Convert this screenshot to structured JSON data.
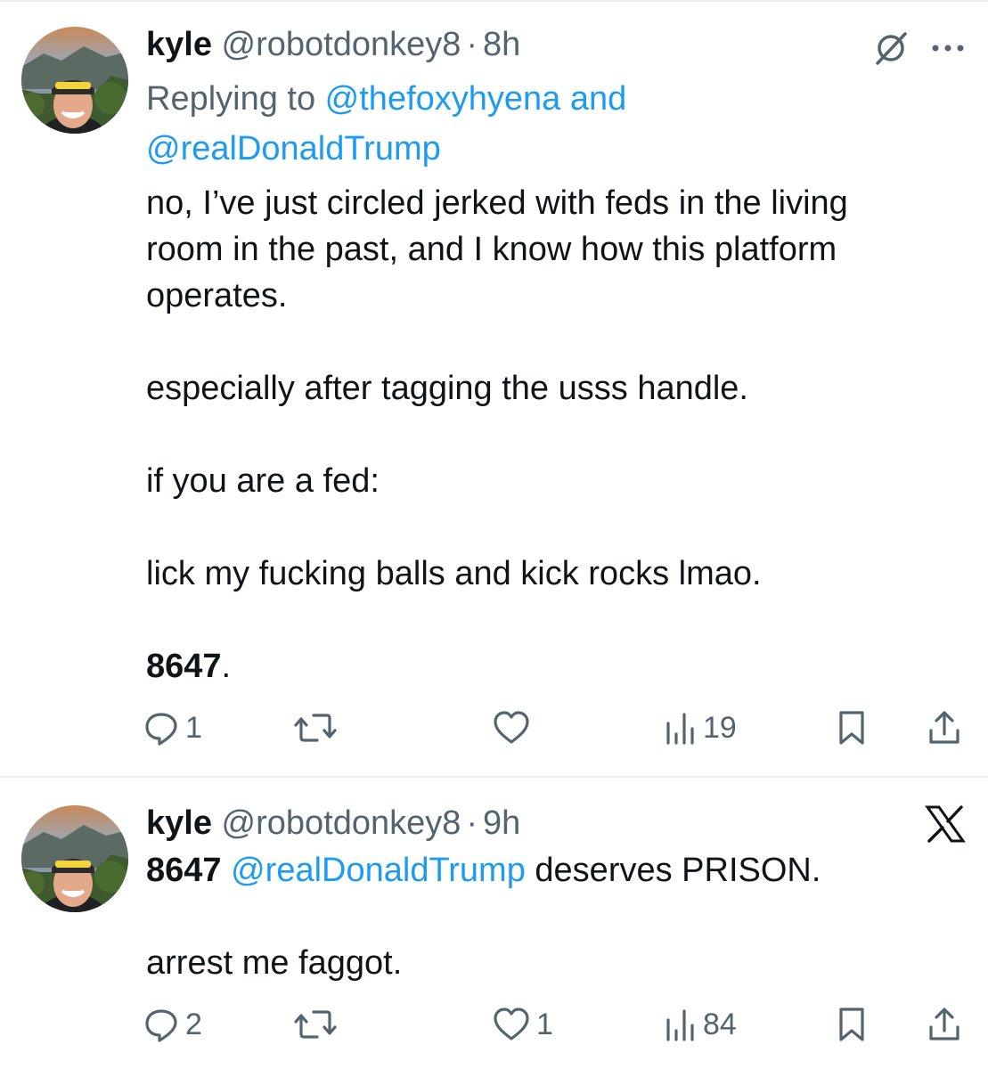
{
  "tweets": [
    {
      "name": "kyle",
      "handle": "@robotdonkey8",
      "separator": "·",
      "time": "8h",
      "reply_prefix": "Replying to ",
      "reply_mention_1": "@thefoxyhyena",
      "reply_and": " and",
      "reply_mention_2": "@realDonaldTrump",
      "body_lines": [
        "no, I’ve just circled jerked with feds  in the living",
        "room in the past, and I know how this platform",
        "operates.",
        "especially after tagging the usss handle.",
        "if you are a fed:",
        "lick my fucking balls and kick rocks lmao."
      ],
      "closing_bold": "8647",
      "closing_rest": ".",
      "reply_count": "1",
      "retweet_count": "",
      "like_count": "",
      "views_count": "19",
      "corner_icons": [
        "grok-icon",
        "more-icon"
      ]
    },
    {
      "name": "kyle",
      "handle": "@robotdonkey8",
      "separator": "·",
      "time": "9h",
      "first_bold": "8647",
      "first_space": " ",
      "first_mention": "@realDonaldTrump",
      "first_rest": " deserves PRISON.",
      "second_line": "arrest me faggot.",
      "reply_count": "2",
      "retweet_count": "",
      "like_count": "1",
      "views_count": "84",
      "corner_icons": [
        "x-logo-icon"
      ]
    }
  ],
  "colors": {
    "text": "#0f1419",
    "secondary": "#536471",
    "link": "#1d9bf0",
    "divider": "#eceff1"
  }
}
